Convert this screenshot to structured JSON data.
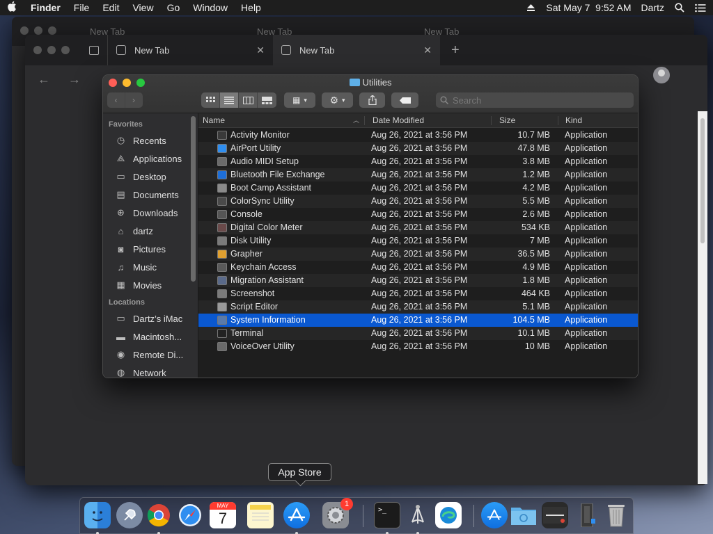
{
  "menubar": {
    "apple_icon": "apple-logo-icon",
    "items": [
      "Finder",
      "File",
      "Edit",
      "View",
      "Go",
      "Window",
      "Help"
    ],
    "datetime": "Sat May 7  9:52 AM",
    "user": "Dartz"
  },
  "browser": {
    "tabs": [
      "New Tab",
      "New Tab"
    ],
    "back_tabs": [
      "New Tab",
      "New Tab",
      "New Tab"
    ]
  },
  "finder": {
    "title": "Utilities",
    "search_placeholder": "Search",
    "sidebar": {
      "favorites_label": "Favorites",
      "favorites": [
        {
          "label": "Recents",
          "icon": "clock-icon"
        },
        {
          "label": "Applications",
          "icon": "applications-icon"
        },
        {
          "label": "Desktop",
          "icon": "desktop-icon"
        },
        {
          "label": "Documents",
          "icon": "document-icon"
        },
        {
          "label": "Downloads",
          "icon": "download-icon"
        },
        {
          "label": "dartz",
          "icon": "home-icon"
        },
        {
          "label": "Pictures",
          "icon": "camera-icon"
        },
        {
          "label": "Music",
          "icon": "music-note-icon"
        },
        {
          "label": "Movies",
          "icon": "film-icon"
        }
      ],
      "locations_label": "Locations",
      "locations": [
        {
          "label": "Dartz’s iMac",
          "icon": "imac-icon"
        },
        {
          "label": "Macintosh...",
          "icon": "hard-drive-icon"
        },
        {
          "label": "Remote Di...",
          "icon": "disc-icon"
        },
        {
          "label": "Network",
          "icon": "globe-icon"
        }
      ]
    },
    "columns": {
      "name": "Name",
      "date": "Date Modified",
      "size": "Size",
      "kind": "Kind"
    },
    "rows": [
      {
        "name": "Activity Monitor",
        "date": "Aug 26, 2021 at 3:56 PM",
        "size": "10.7 MB",
        "kind": "Application"
      },
      {
        "name": "AirPort Utility",
        "date": "Aug 26, 2021 at 3:56 PM",
        "size": "47.8 MB",
        "kind": "Application"
      },
      {
        "name": "Audio MIDI Setup",
        "date": "Aug 26, 2021 at 3:56 PM",
        "size": "3.8 MB",
        "kind": "Application"
      },
      {
        "name": "Bluetooth File Exchange",
        "date": "Aug 26, 2021 at 3:56 PM",
        "size": "1.2 MB",
        "kind": "Application"
      },
      {
        "name": "Boot Camp Assistant",
        "date": "Aug 26, 2021 at 3:56 PM",
        "size": "4.2 MB",
        "kind": "Application"
      },
      {
        "name": "ColorSync Utility",
        "date": "Aug 26, 2021 at 3:56 PM",
        "size": "5.5 MB",
        "kind": "Application"
      },
      {
        "name": "Console",
        "date": "Aug 26, 2021 at 3:56 PM",
        "size": "2.6 MB",
        "kind": "Application"
      },
      {
        "name": "Digital Color Meter",
        "date": "Aug 26, 2021 at 3:56 PM",
        "size": "534 KB",
        "kind": "Application"
      },
      {
        "name": "Disk Utility",
        "date": "Aug 26, 2021 at 3:56 PM",
        "size": "7 MB",
        "kind": "Application"
      },
      {
        "name": "Grapher",
        "date": "Aug 26, 2021 at 3:56 PM",
        "size": "36.5 MB",
        "kind": "Application"
      },
      {
        "name": "Keychain Access",
        "date": "Aug 26, 2021 at 3:56 PM",
        "size": "4.9 MB",
        "kind": "Application"
      },
      {
        "name": "Migration Assistant",
        "date": "Aug 26, 2021 at 3:56 PM",
        "size": "1.8 MB",
        "kind": "Application"
      },
      {
        "name": "Screenshot",
        "date": "Aug 26, 2021 at 3:56 PM",
        "size": "464 KB",
        "kind": "Application"
      },
      {
        "name": "Script Editor",
        "date": "Aug 26, 2021 at 3:56 PM",
        "size": "5.1 MB",
        "kind": "Application"
      },
      {
        "name": "System Information",
        "date": "Aug 26, 2021 at 3:56 PM",
        "size": "104.5 MB",
        "kind": "Application"
      },
      {
        "name": "Terminal",
        "date": "Aug 26, 2021 at 3:56 PM",
        "size": "10.1 MB",
        "kind": "Application"
      },
      {
        "name": "VoiceOver Utility",
        "date": "Aug 26, 2021 at 3:56 PM",
        "size": "10 MB",
        "kind": "Application"
      }
    ],
    "selected_row": "System Information"
  },
  "dock": {
    "tooltip": "App Store",
    "calendar_month": "MAY",
    "calendar_day": "7",
    "settings_badge": "1"
  },
  "colors": {
    "selection": "#0a58d0",
    "close": "#ff5f57",
    "minimize": "#febc2e",
    "zoom": "#28c840"
  }
}
